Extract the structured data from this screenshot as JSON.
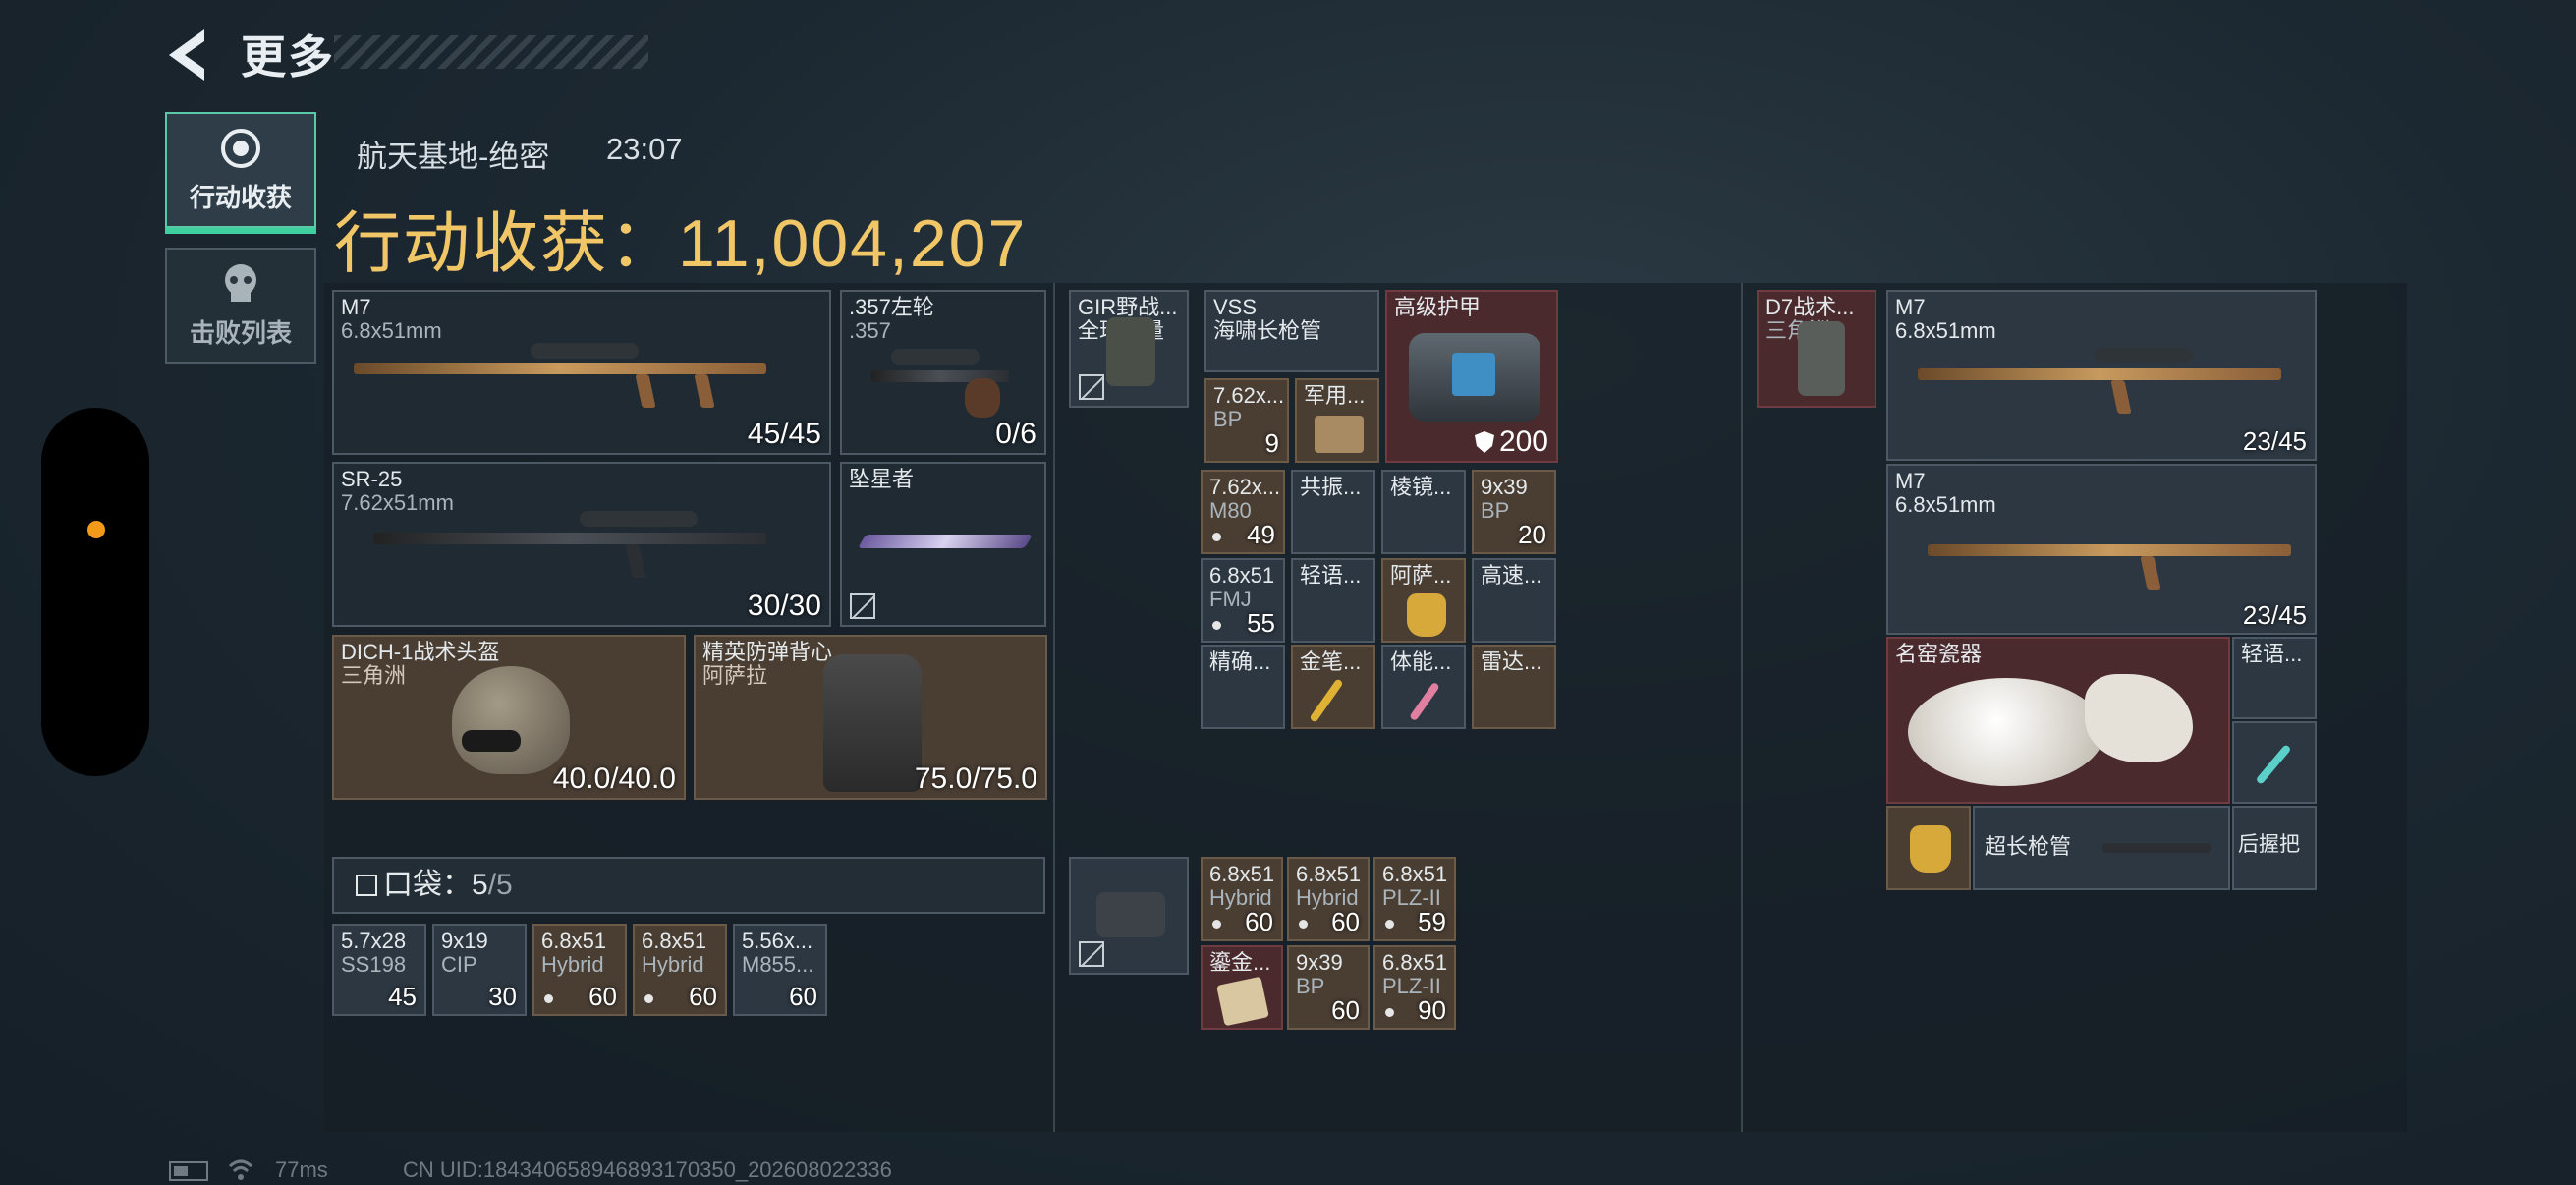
{
  "header": {
    "title": "更多",
    "back_icon": "back-arrow-icon"
  },
  "nav": {
    "tabs": [
      {
        "label": "行动收获",
        "icon": "target-icon",
        "active": true
      },
      {
        "label": "击败列表",
        "icon": "skull-icon",
        "active": false
      }
    ]
  },
  "raid": {
    "map": "航天基地-绝密",
    "time": "23:07",
    "haul_label": "行动收获：",
    "haul_value": "11,004,207"
  },
  "loadout": {
    "primary": {
      "name": "M7",
      "ammo": "6.8x51mm",
      "count": "45/45"
    },
    "sidearm": {
      "name": ".357左轮",
      "ammo": ".357",
      "count": "0/6"
    },
    "secondary": {
      "name": "SR-25",
      "ammo": "7.62x51mm",
      "count": "30/30"
    },
    "melee": {
      "name": "坠星者"
    },
    "helmet": {
      "name": "DICH-1战术头盔",
      "maker": "三角洲",
      "durability": "40.0/40.0"
    },
    "armor": {
      "name": "精英防弹背心",
      "maker": "阿萨拉",
      "durability": "75.0/75.0"
    }
  },
  "rig": {
    "name": "GIR野战...",
    "sub": "全球力量"
  },
  "pouch": [
    {
      "name": "VSS",
      "sub": "海啸长枪管"
    },
    {
      "name": "高级护甲",
      "value": "200"
    },
    {
      "name": "7.62x...",
      "sub": "BP",
      "count": "9"
    },
    {
      "name": "军用..."
    }
  ],
  "backpack_grid": [
    {
      "name": "7.62x...",
      "sub": "M80",
      "count": "49"
    },
    {
      "name": "共振..."
    },
    {
      "name": "棱镜..."
    },
    {
      "name": "9x39",
      "sub": "BP",
      "count": "20"
    },
    {
      "name": "6.8x51",
      "sub": "FMJ",
      "count": "55"
    },
    {
      "name": "轻语..."
    },
    {
      "name": "阿萨..."
    },
    {
      "name": "高速..."
    },
    {
      "name": "精确..."
    },
    {
      "name": "金笔..."
    },
    {
      "name": "体能..."
    },
    {
      "name": "雷达..."
    }
  ],
  "pocket": {
    "label": "口袋：",
    "count": "5",
    "total": "5",
    "items": [
      {
        "name": "5.7x28",
        "sub": "SS198",
        "count": "45"
      },
      {
        "name": "9x19",
        "sub": "CIP",
        "count": "30"
      },
      {
        "name": "6.8x51",
        "sub": "Hybrid",
        "count": "60"
      },
      {
        "name": "6.8x51",
        "sub": "Hybrid",
        "count": "60"
      },
      {
        "name": "5.56x...",
        "sub": "M855...",
        "count": "60"
      }
    ]
  },
  "safe_box": [
    {
      "name": "6.8x51",
      "sub": "Hybrid",
      "count": "60"
    },
    {
      "name": "6.8x51",
      "sub": "Hybrid",
      "count": "60"
    },
    {
      "name": "6.8x51",
      "sub": "PLZ-II",
      "count": "59"
    },
    {
      "name": "鎏金..."
    },
    {
      "name": "9x39",
      "sub": "BP",
      "count": "60"
    },
    {
      "name": "6.8x51",
      "sub": "PLZ-II",
      "count": "90"
    }
  ],
  "loot_right": {
    "vest": {
      "name": "D7战术...",
      "sub": "三角洲"
    },
    "guns": [
      {
        "name": "M7",
        "ammo": "6.8x51mm",
        "count": "23/45"
      },
      {
        "name": "M7",
        "ammo": "6.8x51mm",
        "count": "23/45"
      }
    ],
    "vase": {
      "name": "名窑瓷器"
    },
    "small": [
      {
        "name": "轻语..."
      },
      {
        "name": ""
      },
      {
        "name": "超长枪管"
      },
      {
        "name": "后握把"
      }
    ]
  },
  "footer": {
    "ping": "77ms",
    "uid": "CN UID:1843406589468931703​50_202608022336"
  },
  "colors": {
    "accent_gold": "#f1c667",
    "active_tab": "#3fd0a0",
    "status_dot": "#f39a1a"
  }
}
